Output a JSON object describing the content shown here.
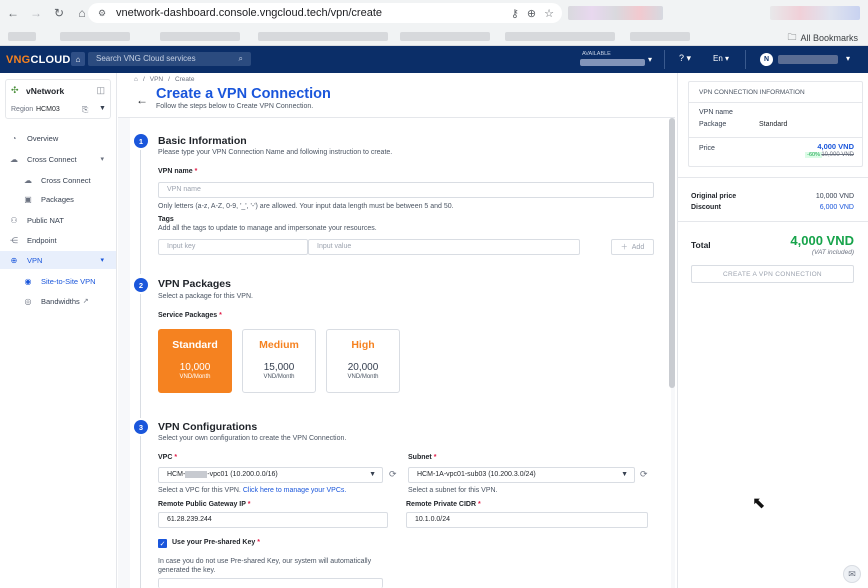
{
  "browser": {
    "url": "vnetwork-dashboard.console.vngcloud.tech/vpn/create",
    "all_bookmarks": "All Bookmarks"
  },
  "topbar": {
    "logo_part1": "VNG",
    "logo_part2": "CLOUD",
    "search_placeholder": "Search VNG Cloud services",
    "available_label": "AVAILABLE",
    "language": "En",
    "avatar_initial": "N"
  },
  "sidebar": {
    "title": "vNetwork",
    "region_label": "Region",
    "region_value": "HCM03",
    "items": [
      {
        "label": "Overview",
        "icon": "overview-icon"
      },
      {
        "label": "Cross Connect",
        "icon": "cross-connect-icon"
      },
      {
        "label": "Cross Connect",
        "icon": "cross-connect-sub-icon"
      },
      {
        "label": "Packages",
        "icon": "packages-icon"
      },
      {
        "label": "Public NAT",
        "icon": "public-nat-icon"
      },
      {
        "label": "Endpoint",
        "icon": "endpoint-icon"
      },
      {
        "label": "VPN",
        "icon": "vpn-icon"
      },
      {
        "label": "Site-to-Site VPN",
        "icon": "site-to-site-icon"
      },
      {
        "label": "Bandwidths",
        "icon": "bandwidths-icon"
      }
    ]
  },
  "breadcrumb": {
    "home": "⌂",
    "vpn": "VPN",
    "create": "Create"
  },
  "page": {
    "title": "Create a VPN Connection",
    "subtitle": "Follow the steps below to Create VPN Connection."
  },
  "section1": {
    "number": "1",
    "title": "Basic Information",
    "subtitle": "Please type your VPN Connection Name and following instruction to create.",
    "vpn_name_label": "VPN name",
    "vpn_name_placeholder": "VPN name",
    "vpn_name_hint": "Only letters (a-z, A-Z, 0-9, '_', '-') are allowed. Your input data length must be between 5 and 50.",
    "tags_label": "Tags",
    "tags_hint": "Add all the tags to update to manage and impersonate your resources.",
    "key_placeholder": "Input key",
    "value_placeholder": "Input value",
    "add_label": "Add"
  },
  "section2": {
    "number": "2",
    "title": "VPN Packages",
    "subtitle": "Select a package for this VPN.",
    "service_label": "Service Packages",
    "packages": [
      {
        "name": "Standard",
        "price": "10,000",
        "unit": "VND/Month",
        "selected": true
      },
      {
        "name": "Medium",
        "price": "15,000",
        "unit": "VND/Month",
        "selected": false
      },
      {
        "name": "High",
        "price": "20,000",
        "unit": "VND/Month",
        "selected": false
      }
    ]
  },
  "section3": {
    "number": "3",
    "title": "VPN Configurations",
    "subtitle": "Select your own configuration to create the VPN Connection.",
    "vpc_label": "VPC",
    "vpc_value_prefix": "HCM-",
    "vpc_value_suffix": "-vpc01 (10.200.0.0/16)",
    "vpc_hint": "Select a VPC for this VPN.",
    "vpc_link": "Click here to manage your VPCs.",
    "subnet_label": "Subnet",
    "subnet_value": "HCM-1A-vpc01-sub03 (10.200.3.0/24)",
    "subnet_hint": "Select a subnet for this VPN.",
    "gateway_label": "Remote Public Gateway IP",
    "gateway_value": "61.28.239.244",
    "cidr_label": "Remote Private CIDR",
    "cidr_value": "10.1.0.0/24",
    "psk_label": "Use your Pre-shared Key",
    "psk_hint": "In case you do not use Pre-shared Key, our system will automatically generated the key."
  },
  "summary": {
    "box_title": "VPN CONNECTION INFORMATION",
    "vpn_name_label": "VPN name",
    "package_label": "Package",
    "package_value": "Standard",
    "price_label": "Price",
    "price_value": "4,000 VND",
    "discount_badge": "-60%",
    "old_price": "10,000 VND",
    "original_price_label": "Original price",
    "original_price_value": "10,000 VND",
    "discount_label": "Discount",
    "discount_value": "6,000 VND",
    "total_label": "Total",
    "total_value": "4,000 VND",
    "vat_note": "(VAT included)",
    "create_button": "CREATE A VPN CONNECTION"
  },
  "colors": {
    "brand_navy": "#0b2e68",
    "accent_blue": "#1a56db",
    "accent_orange": "#f58220",
    "success_green": "#16a34a"
  }
}
